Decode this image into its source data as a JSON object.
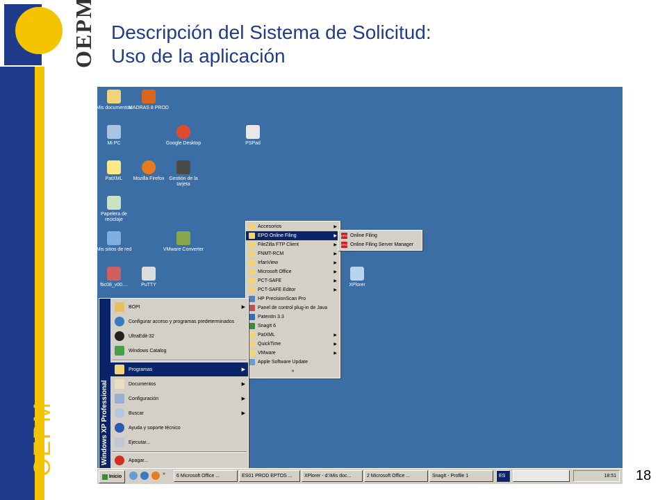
{
  "slide": {
    "title_line1": "Descripción del Sistema de Solicitud:",
    "title_line2": "Uso de la aplicación",
    "logo_text": "OEPM",
    "side_text": "OEPM",
    "page_number": "18"
  },
  "desktop_icons": [
    {
      "label": "Mis documentos",
      "icon": "folder-icon"
    },
    {
      "label": "MADRAS 8 PROD",
      "icon": "app-icon"
    },
    {
      "label": "Mi PC",
      "icon": "computer-icon"
    },
    {
      "label": "Google Desktop",
      "icon": "google-desktop-icon"
    },
    {
      "label": "PSPad",
      "icon": "editor-icon"
    },
    {
      "label": "PatXML",
      "icon": "xml-icon"
    },
    {
      "label": "Mozilla Firefox",
      "icon": "firefox-icon"
    },
    {
      "label": "Gestión de la tarjeta",
      "icon": "card-icon"
    },
    {
      "label": "Papelera de reciclaje",
      "icon": "recycle-bin-icon"
    },
    {
      "label": "Mis sitios de red",
      "icon": "network-icon"
    },
    {
      "label": "VMware Converter",
      "icon": "vmware-icon"
    },
    {
      "label": "ftic08_v00....",
      "icon": "file-icon"
    },
    {
      "label": "PuTTY",
      "icon": "putty-icon"
    },
    {
      "label": "XPlorer",
      "icon": "xplorer-icon"
    }
  ],
  "start_menu": {
    "band_text": "Windows XP Professional",
    "pinned": [
      {
        "label": "BOPI",
        "has_arrow": true
      },
      {
        "label": "Configurar acceso y programas predeterminados",
        "has_arrow": false
      },
      {
        "label": "UltraEdit-32",
        "has_arrow": false
      },
      {
        "label": "Windows Catalog",
        "has_arrow": false
      }
    ],
    "items": [
      {
        "label": "Programas",
        "has_arrow": true,
        "selected": true
      },
      {
        "label": "Documentos",
        "has_arrow": true
      },
      {
        "label": "Configuración",
        "has_arrow": true
      },
      {
        "label": "Buscar",
        "has_arrow": true
      },
      {
        "label": "Ayuda y soporte técnico",
        "has_arrow": false
      },
      {
        "label": "Ejecutar...",
        "has_arrow": false
      }
    ],
    "shutdown": "Apagar..."
  },
  "programs_menu": [
    {
      "label": "Accesorios",
      "arrow": true
    },
    {
      "label": "EPO Online Filing",
      "arrow": true,
      "selected": true
    },
    {
      "label": "FileZilla FTP Client",
      "arrow": true
    },
    {
      "label": "FNMT-RCM",
      "arrow": true
    },
    {
      "label": "IrfanView",
      "arrow": true
    },
    {
      "label": "Microsoft Office",
      "arrow": true
    },
    {
      "label": "PCT-SAFE",
      "arrow": true
    },
    {
      "label": "PCT-SAFE Editor",
      "arrow": true
    },
    {
      "label": "HP PrecisionScan Pro",
      "arrow": false
    },
    {
      "label": "Panel de control plug-in de Java",
      "arrow": false
    },
    {
      "label": "PatentIn 3.3",
      "arrow": false
    },
    {
      "label": "SnagIt 6",
      "arrow": false
    },
    {
      "label": "PatXML",
      "arrow": true
    },
    {
      "label": "QuickTime",
      "arrow": true
    },
    {
      "label": "VMware",
      "arrow": true
    },
    {
      "label": "Apple Software Update",
      "arrow": false
    }
  ],
  "programs_more": "»",
  "epo_menu": [
    {
      "label": "Online Filing",
      "badge": "EPO"
    },
    {
      "label": "Online Filing Server Manager",
      "badge": "EPO"
    }
  ],
  "taskbar": {
    "start": "Inicio",
    "buttons": [
      "6 Microsoft Office ...",
      "ES01 PROD EPTOS ...",
      "XPlorer - d:\\Mis doc...",
      "2 Microsoft Office ...",
      "SnagIt - Profile 1",
      "ES"
    ],
    "clock": "18:51"
  },
  "colors": {
    "desktop": "#3b6ea5",
    "selection": "#0a246a",
    "oepm_blue": "#1f3c8c",
    "oepm_yellow": "#f5c400"
  }
}
